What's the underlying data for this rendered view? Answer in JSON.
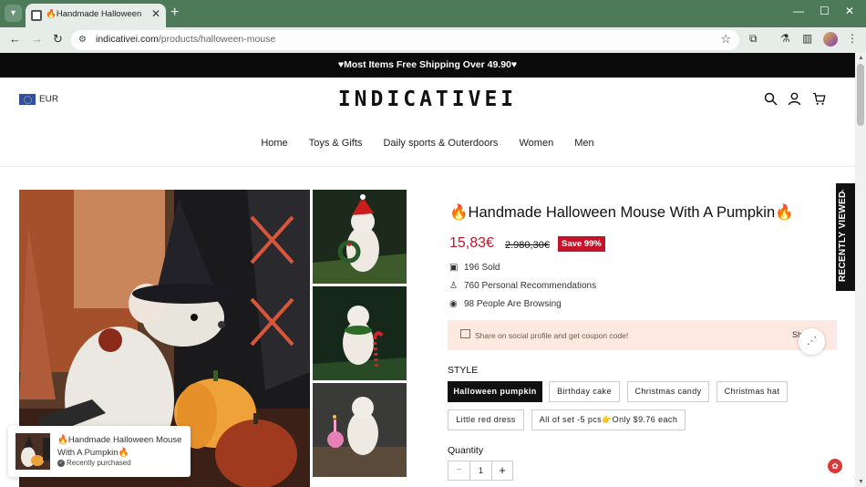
{
  "browser": {
    "tab_title": "🔥Handmade Halloween Mouse With A Pumpkin🔥",
    "url_host": "indicativei.com",
    "url_path": "/products/halloween-mouse"
  },
  "announcement": "♥Most Items Free Shipping Over 49.90♥",
  "header": {
    "currency": "EUR",
    "logo": "INDICATIVEI",
    "nav": [
      "Home",
      "Toys & Gifts",
      "Daily sports & Outerdoors",
      "Women",
      "Men"
    ]
  },
  "product": {
    "title": "🔥Handmade Halloween Mouse With A Pumpkin🔥",
    "price": "15,83€",
    "old_price": "2.980,30€",
    "save_badge": "Save 99%",
    "stats": {
      "sold": "196 Sold",
      "recommendations": "760 Personal Recommendations",
      "browsing": "98 People Are Browsing"
    },
    "share_text": "Share on social profile and get coupon code!",
    "share_short": "Sh",
    "style_label": "STYLE",
    "styles": [
      "Halloween pumpkin",
      "Birthday cake",
      "Christmas candy",
      "Christmas hat",
      "Little red dress",
      "All of set -5 pcs👉Only $9.76 each"
    ],
    "selected_style": "Halloween pumpkin",
    "quantity_label": "Quantity",
    "quantity": "1",
    "qty_minus": "−",
    "qty_plus": "+"
  },
  "recently_viewed": "RECENTLY VIEWED",
  "toast": {
    "title": "🔥Handmade Halloween Mouse With A Pumpkin🔥",
    "subtitle": "Recently purchased"
  },
  "colors": {
    "chrome_green": "#4d7a59",
    "accent_red": "#c4142b",
    "share_bg": "#fde9e1"
  }
}
